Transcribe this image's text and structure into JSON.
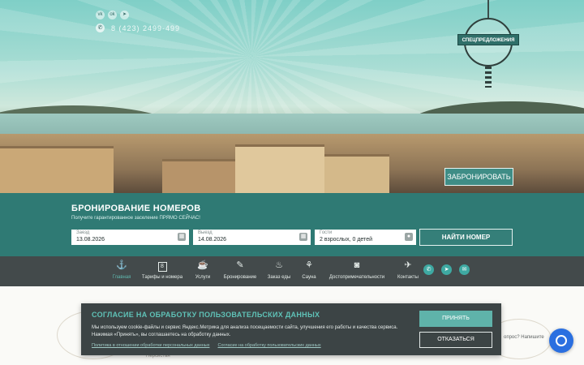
{
  "header": {
    "social_icons": [
      "vk-icon",
      "ok-icon",
      "telegram-icon"
    ],
    "phone": "8 (423) 2499-499",
    "offer_badge": "СПЕЦПРЕДЛОЖЕНИЯ",
    "hero_book_button": "ЗАБРОНИРОВАТЬ"
  },
  "booking": {
    "title": "БРОНИРОВАНИЕ НОМЕРОВ",
    "subtitle": "Получите гарантированное заселение ПРЯМО СЕЙЧАС!",
    "checkin": {
      "label": "Заезд",
      "value": "13.08.2026"
    },
    "checkout": {
      "label": "Выезд",
      "value": "14.08.2026"
    },
    "guests": {
      "label": "Гости",
      "value": "2 взрослых, 0 детей"
    },
    "find_button": "НАЙТИ НОМЕР"
  },
  "nav": {
    "items": [
      {
        "label": "Главная",
        "icon": "anchor-icon",
        "active": true
      },
      {
        "label": "Тарифы и номера",
        "icon": "room-8-icon"
      },
      {
        "label": "Услуги",
        "icon": "coffee-cup-icon"
      },
      {
        "label": "Бронирование",
        "icon": "booking-icon"
      },
      {
        "label": "Заказ еды",
        "icon": "food-order-icon"
      },
      {
        "label": "Сауна",
        "icon": "sauna-icon"
      },
      {
        "label": "Достопримечательности",
        "icon": "camera-icon"
      },
      {
        "label": "Контакты",
        "icon": "plane-icon"
      }
    ],
    "messengers": [
      "whatsapp-icon",
      "telegram-icon",
      "chat-icon"
    ]
  },
  "content": {
    "peek_left": "Персистан",
    "peek_right": "опрос? Напишите"
  },
  "cookie": {
    "title": "СОГЛАСИЕ НА ОБРАБОТКУ ПОЛЬЗОВАТЕЛЬСКИХ ДАННЫХ",
    "body": "Мы используем cookie-файлы и сервис Яндекс.Метрика для анализа посещаемости сайта, улучшения его работы и качества сервиса. Нажимая «Принять», вы соглашаетесь на обработку данных.",
    "link_policy": "Политика в отношении обработки персональных данных",
    "link_consent": "Согласие на обработку пользовательских данных",
    "accept": "ПРИНЯТЬ",
    "decline": "ОТКАЗАТЬСЯ"
  }
}
